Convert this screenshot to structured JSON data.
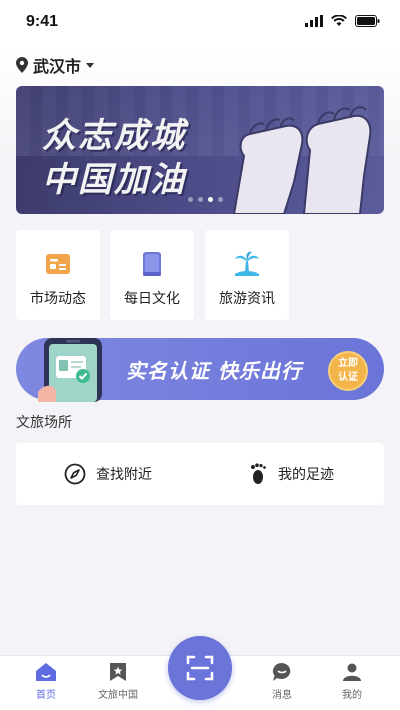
{
  "status_bar": {
    "time": "9:41"
  },
  "location": {
    "city": "武汉市"
  },
  "banner": {
    "line1": "众志成城",
    "line2": "中国加油",
    "dot_count": 4,
    "active_dot": 2
  },
  "quick_links": [
    {
      "label": "市场动态",
      "icon": "news-icon",
      "color": "#f0a54a"
    },
    {
      "label": "每日文化",
      "icon": "book-icon",
      "color": "#6f79dc"
    },
    {
      "label": "旅游资讯",
      "icon": "palm-beach-icon",
      "color": "#3fb6e8"
    }
  ],
  "promo": {
    "text": "实名认证  快乐出行",
    "badge_line1": "立即",
    "badge_line2": "认证"
  },
  "venues": {
    "title": "文旅场所",
    "items": [
      {
        "label": "查找附近",
        "icon": "compass-icon"
      },
      {
        "label": "我的足迹",
        "icon": "footprint-icon"
      }
    ]
  },
  "tabbar": {
    "items": [
      {
        "label": "首页",
        "icon": "home-icon",
        "active": true
      },
      {
        "label": "文旅中国",
        "icon": "bookmark-star-icon",
        "active": false
      },
      {
        "label": "消息",
        "icon": "chat-icon",
        "active": false
      },
      {
        "label": "我的",
        "icon": "user-icon",
        "active": false
      }
    ],
    "scan_icon": "scan-icon"
  },
  "colors": {
    "accent": "#6b74d8",
    "badge": "#f3b54a"
  }
}
